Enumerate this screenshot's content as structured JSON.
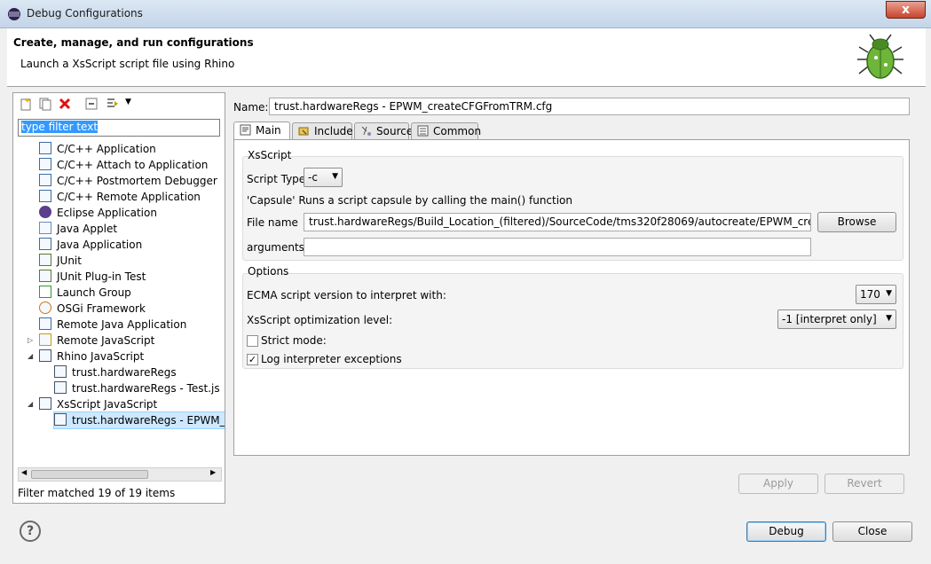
{
  "window": {
    "title": "Debug Configurations",
    "close_glyph": "x"
  },
  "header": {
    "title": "Create, manage, and run configurations",
    "subtitle": "Launch a XsScript script file using Rhino"
  },
  "left": {
    "filter_placeholder": "type filter text",
    "tree": [
      {
        "label": "C/C++ Application",
        "icon": "c-app-icon",
        "level": 0
      },
      {
        "label": "C/C++ Attach to Application",
        "icon": "c-app-icon",
        "level": 0
      },
      {
        "label": "C/C++ Postmortem Debugger",
        "icon": "c-app-icon",
        "level": 0
      },
      {
        "label": "C/C++ Remote Application",
        "icon": "c-app-icon",
        "level": 0
      },
      {
        "label": "Eclipse Application",
        "icon": "eclipse-icon",
        "level": 0
      },
      {
        "label": "Java Applet",
        "icon": "java-applet-icon",
        "level": 0
      },
      {
        "label": "Java Application",
        "icon": "java-app-icon",
        "level": 0
      },
      {
        "label": "JUnit",
        "icon": "junit-icon",
        "level": 0
      },
      {
        "label": "JUnit Plug-in Test",
        "icon": "junit-plugin-icon",
        "level": 0
      },
      {
        "label": "Launch Group",
        "icon": "launch-group-icon",
        "level": 0
      },
      {
        "label": "OSGi Framework",
        "icon": "osgi-icon",
        "level": 0
      },
      {
        "label": "Remote Java Application",
        "icon": "remote-java-icon",
        "level": 0
      },
      {
        "label": "Remote JavaScript",
        "icon": "remote-js-icon",
        "level": 0,
        "expander": "collapsed"
      },
      {
        "label": "Rhino JavaScript",
        "icon": "rhino-icon",
        "level": 0,
        "expander": "expanded"
      },
      {
        "label": "trust.hardwareRegs",
        "icon": "rhino-icon",
        "level": 1
      },
      {
        "label": "trust.hardwareRegs - Test.js",
        "icon": "rhino-icon",
        "level": 1
      },
      {
        "label": "XsScript JavaScript",
        "icon": "rhino-icon",
        "level": 0,
        "expander": "expanded"
      },
      {
        "label": "trust.hardwareRegs - EPWM_createCFGFromTRM.cfg",
        "icon": "rhino-icon",
        "level": 1,
        "selected": true
      }
    ],
    "status": "Filter matched 19 of 19 items"
  },
  "right": {
    "name_label": "Name:",
    "name_value": "trust.hardwareRegs - EPWM_createCFGFromTRM.cfg",
    "tabs": [
      {
        "label": "Main",
        "icon": "main-tab-icon",
        "active": true
      },
      {
        "label": "Include",
        "icon": "include-tab-icon"
      },
      {
        "label": "Source",
        "icon": "source-tab-icon"
      },
      {
        "label": "Common",
        "icon": "common-tab-icon"
      }
    ],
    "xsscript": {
      "group_title": "XsScript",
      "script_type_label": "Script Type",
      "script_type_value": "-c",
      "capsule_text": "'Capsule'  Runs a script capsule by calling the main() function",
      "file_label": "File name",
      "file_value": "trust.hardwareRegs/Build_Location_(filtered)/SourceCode/tms320f28069/autocreate/EPWM_createCFGFromTRM.cfg",
      "browse_label": "Browse",
      "arguments_label": "arguments",
      "arguments_value": ""
    },
    "options": {
      "group_title": "Options",
      "ecma_label": "ECMA script version to interpret with:",
      "ecma_value": "170",
      "opt_label": "XsScript optimization level:",
      "opt_value": "-1 [interpret only]",
      "strict_label": "Strict mode:",
      "strict_checked": false,
      "log_label": "Log interpreter exceptions",
      "log_checked": true
    },
    "apply_label": "Apply",
    "revert_label": "Revert"
  },
  "footer": {
    "help_glyph": "?",
    "debug_label": "Debug",
    "close_label": "Close"
  }
}
